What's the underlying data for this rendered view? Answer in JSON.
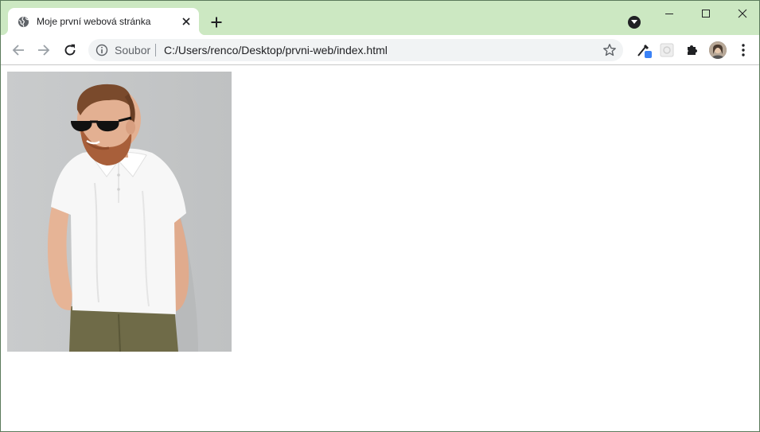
{
  "browser": {
    "tab": {
      "title": "Moje první webová stránka",
      "favicon": "globe-icon",
      "close_icon": "close-icon"
    },
    "new_tab_icon": "plus-icon",
    "tab_search_icon": "chevron-down-icon",
    "window_controls": [
      "minimize-icon",
      "maximize-icon",
      "close-icon"
    ],
    "toolbar": {
      "back_icon": "arrow-left-icon",
      "forward_icon": "arrow-right-icon",
      "reload_icon": "reload-icon",
      "omnibox": {
        "info_icon": "info-icon",
        "scheme_label": "Soubor",
        "url": "C:/Users/renco/Desktop/prvni-web/index.html",
        "bookmark_icon": "star-icon"
      },
      "extensions": [
        "eyedropper-icon",
        "extension-square-icon",
        "puzzle-icon"
      ],
      "profile": "avatar",
      "menu_icon": "more-vert-icon"
    },
    "colors": {
      "tabstrip": "#cce8c2",
      "omnibox": "#f1f3f4",
      "text": "#202124",
      "secondary_text": "#5f6368"
    }
  },
  "page": {
    "image": "photo of a bearded man in sunglasses and white polo shirt leaning against a grey wall"
  }
}
